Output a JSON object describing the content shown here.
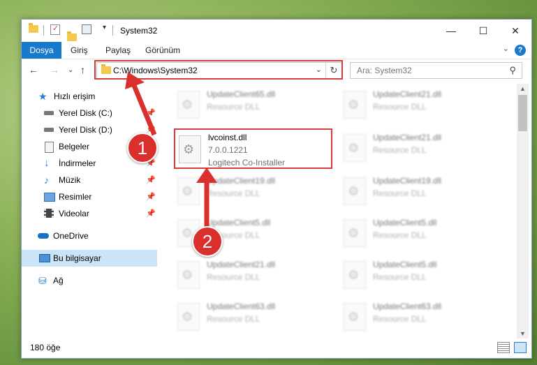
{
  "window": {
    "title": "System32",
    "controls": {
      "minimize": "—",
      "maximize": "☐",
      "close": "✕"
    }
  },
  "ribbon": {
    "tabs": [
      "Dosya",
      "Giriş",
      "Paylaş",
      "Görünüm"
    ],
    "help": "?"
  },
  "nav": {
    "address": "C:\\Windows\\System32",
    "search_placeholder": "Ara: System32"
  },
  "sidebar": {
    "items": [
      {
        "label": "Hızlı erişim",
        "icon": "star-icon"
      },
      {
        "label": "Yerel Disk (C:)",
        "icon": "drive-icon",
        "pinned": true
      },
      {
        "label": "Yerel Disk (D:)",
        "icon": "drive-icon",
        "pinned": true
      },
      {
        "label": "Belgeler",
        "icon": "document-icon",
        "pinned": true
      },
      {
        "label": "İndirmeler",
        "icon": "download-icon",
        "pinned": true
      },
      {
        "label": "Müzik",
        "icon": "music-icon",
        "pinned": true
      },
      {
        "label": "Resimler",
        "icon": "picture-icon",
        "pinned": true
      },
      {
        "label": "Videolar",
        "icon": "video-icon",
        "pinned": true
      },
      {
        "label": "OneDrive",
        "icon": "cloud-icon"
      },
      {
        "label": "Bu bilgisayar",
        "icon": "computer-icon",
        "selected": true
      },
      {
        "label": "Ağ",
        "icon": "network-icon"
      }
    ]
  },
  "files": {
    "highlighted": {
      "name": "lvcoinst.dll",
      "version": "7.0.0.1221",
      "desc": "Logitech Co-Installer"
    },
    "background": [
      {
        "name": "UpdateClient65.dll",
        "desc": "Resource DLL"
      },
      {
        "name": "UpdateClient21.dll",
        "desc": "Resource DLL"
      },
      {
        "name": "UpdateClient21.dll",
        "desc": "Resource DLL"
      },
      {
        "name": "UpdateClient19.dll",
        "desc": "Resource DLL"
      },
      {
        "name": "UpdateClient19.dll",
        "desc": "Resource DLL"
      },
      {
        "name": "UpdateClient5.dll",
        "desc": "Resource DLL"
      },
      {
        "name": "UpdateClient5.dll",
        "desc": "Resource DLL"
      },
      {
        "name": "UpdateClient21.dll",
        "desc": "Resource DLL"
      },
      {
        "name": "UpdateClient5.dll",
        "desc": "Resource DLL"
      },
      {
        "name": "UpdateClient63.dll",
        "desc": "Resource DLL"
      },
      {
        "name": "UpdateClient63.dll",
        "desc": "Resource DLL"
      }
    ]
  },
  "status": {
    "count": "180 öğe"
  },
  "annotations": {
    "step1": "1",
    "step2": "2"
  },
  "colors": {
    "accent": "#1979ca",
    "highlight": "#d93a3a",
    "selection": "#cce4f7"
  }
}
